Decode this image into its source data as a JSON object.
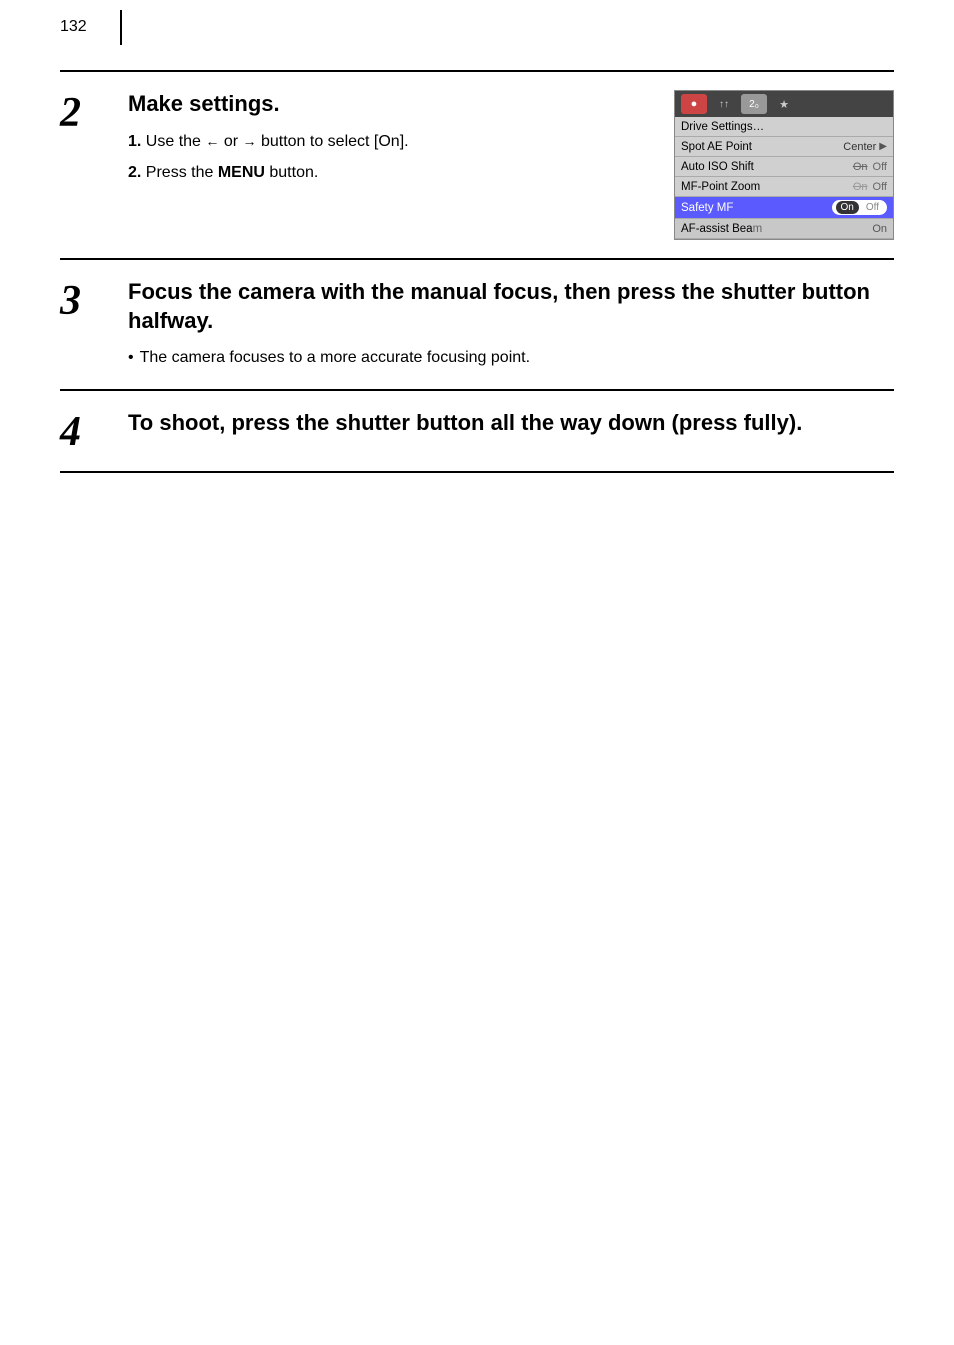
{
  "page": {
    "number": "132",
    "steps": [
      {
        "id": "step2",
        "number": "2",
        "title": "Make settings.",
        "instructions": [
          {
            "num": "1",
            "text_before": "Use the ",
            "arrow_left": "←",
            "connector": " or ",
            "arrow_right": "→",
            "text_after": " button to select [On]."
          },
          {
            "num": "2",
            "text_before": "Press the ",
            "bold_word": "MENU",
            "text_after": " button."
          }
        ],
        "menu": {
          "tabs": [
            {
              "icon": "●",
              "type": "camera",
              "active": false
            },
            {
              "icon": "↑↑",
              "type": "normal",
              "active": false
            },
            {
              "icon": "2₀",
              "type": "normal",
              "active": true
            },
            {
              "icon": "★",
              "type": "normal",
              "active": false
            }
          ],
          "rows": [
            {
              "label": "Drive Settings…",
              "value": "",
              "highlighted": false,
              "has_arrow": false
            },
            {
              "label": "Spot AE Point",
              "value": "Center",
              "highlighted": false,
              "has_arrow": true
            },
            {
              "label": "Auto ISO Shift",
              "value": "On Off",
              "highlighted": false,
              "has_toggle": false,
              "on_strikethrough": true
            },
            {
              "label": "MF-Point Zoom",
              "value": "On Off",
              "highlighted": false,
              "on_strikethrough": false
            },
            {
              "label": "Safety MF",
              "value": "",
              "highlighted": true,
              "has_on_off_toggle": true
            },
            {
              "label": "AF-assist Beam",
              "value": "On",
              "highlighted": false,
              "partial": true
            }
          ]
        }
      },
      {
        "id": "step3",
        "number": "3",
        "title": "Focus the camera with the manual focus, then press the shutter button halfway.",
        "bullet": "The camera focuses to a more accurate focusing point."
      },
      {
        "id": "step4",
        "number": "4",
        "title": "To shoot, press the shutter button all the way down (press fully).",
        "bullet": ""
      }
    ]
  }
}
